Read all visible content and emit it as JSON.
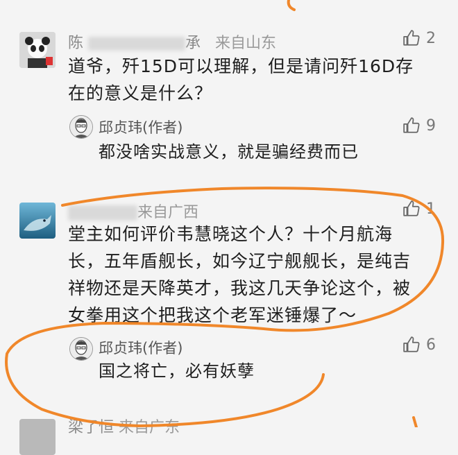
{
  "comments": [
    {
      "user": "陈",
      "user_suffix": "承",
      "location": "来自山东",
      "text_line1": "道爷，歼15D可以理解，但是请问歼16D存",
      "text_line2": "在的意义是什么？",
      "likes": "2",
      "reply": {
        "author": "邱贞玮(作者)",
        "text": "都没啥实战意义，就是骗经费而已",
        "likes": "9"
      }
    },
    {
      "location": "来自广西",
      "text_line1": "堂主如何评价韦慧晓这个人？十个月航海",
      "text_line2": "长，五年盾舰长，如今辽宁舰舰长，是纯吉",
      "text_line3": "祥物还是天降英才，我这几天争论这个，被",
      "text_line4": "女拳用这个把我这个老军迷锤爆了～",
      "likes": "1",
      "reply": {
        "author": "邱贞玮(作者)",
        "text": "国之将亡，必有妖孽",
        "likes": "6"
      }
    },
    {
      "user": "梁了恒",
      "location": "来自广东"
    }
  ],
  "colors": {
    "annotation": "#f0872a",
    "background": "#f4f4f4"
  }
}
